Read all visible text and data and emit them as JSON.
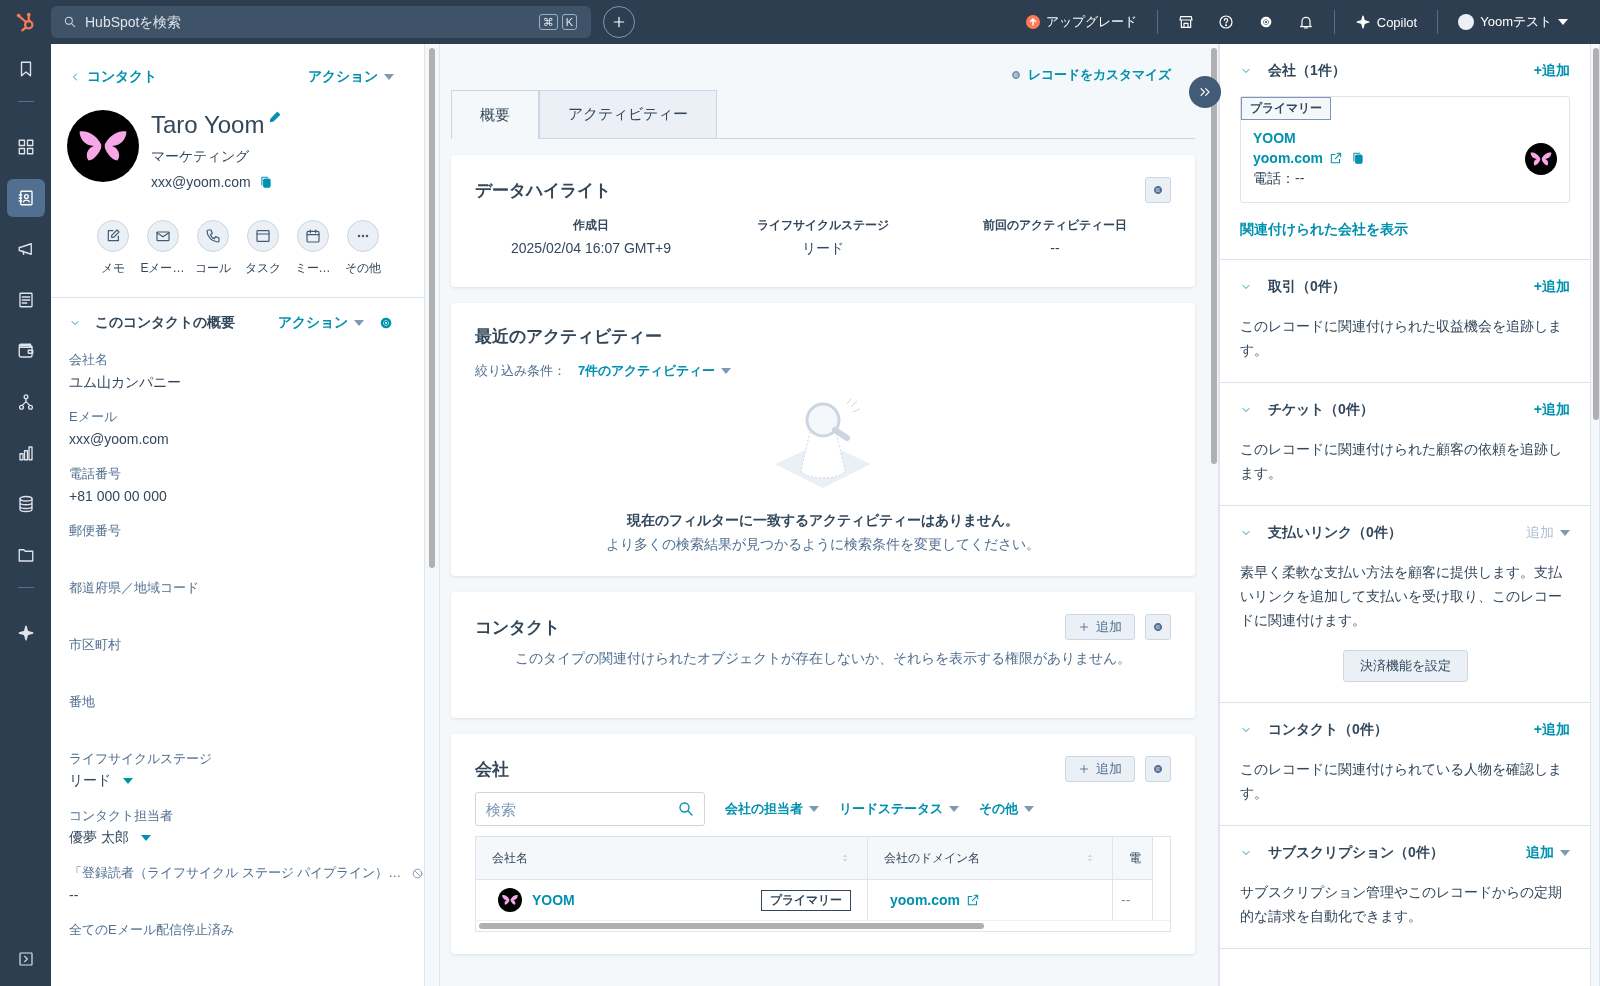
{
  "topbar": {
    "search_placeholder": "HubSpotを検索",
    "shortcut_keys": [
      "⌘",
      "K"
    ],
    "upgrade": "アップグレード",
    "copilot": "Copilot",
    "user": "Yoomテスト"
  },
  "rail": {
    "groups": [
      [
        {
          "kind": "bookmark",
          "selected": false
        }
      ],
      [
        {
          "kind": "grid",
          "selected": false
        },
        {
          "kind": "contacts",
          "selected": true
        },
        {
          "kind": "megaphone",
          "selected": false
        },
        {
          "kind": "document",
          "selected": false
        },
        {
          "kind": "wallet",
          "selected": false
        },
        {
          "kind": "network",
          "selected": false
        },
        {
          "kind": "chart",
          "selected": false
        },
        {
          "kind": "database",
          "selected": false
        },
        {
          "kind": "folder",
          "selected": false
        }
      ],
      [
        {
          "kind": "sparkle",
          "selected": false
        }
      ]
    ]
  },
  "contact": {
    "back": "コンタクト",
    "actions": "アクション",
    "name": "Taro Yoom",
    "job": "マーケティング",
    "email": "xxx@yoom.com",
    "quick_actions": [
      {
        "kind": "note",
        "label": "メモ"
      },
      {
        "kind": "email",
        "label": "Eメー…"
      },
      {
        "kind": "call",
        "label": "コール"
      },
      {
        "kind": "task",
        "label": "タスク"
      },
      {
        "kind": "meeting",
        "label": "ミー…"
      },
      {
        "kind": "more",
        "label": "その他"
      }
    ],
    "about": {
      "title": "このコンタクトの概要",
      "actions": "アクション",
      "expanded": true,
      "fields": [
        {
          "kind": "text",
          "label": "会社名",
          "value": "ユム山カンパニー"
        },
        {
          "kind": "text",
          "label": "Eメール",
          "value": "xxx@yoom.com"
        },
        {
          "kind": "text",
          "label": "電話番号",
          "value": "+81 000 00 000"
        },
        {
          "kind": "blank",
          "label": "郵便番号"
        },
        {
          "kind": "blank",
          "label": "都道府県／地域コード"
        },
        {
          "kind": "blank",
          "label": "市区町村"
        },
        {
          "kind": "blank",
          "label": "番地"
        },
        {
          "kind": "dropdown",
          "label": "ライフサイクルステージ",
          "value": "リード"
        },
        {
          "kind": "dropdown",
          "label": "コンタクト担当者",
          "value": "優夢 太郎"
        },
        {
          "kind": "restricted",
          "label": "「登録読者（ライフサイクル ステージ パイプライン）…",
          "value": "--"
        },
        {
          "kind": "blank",
          "label": "全てのEメール配信停止済み"
        }
      ]
    }
  },
  "center": {
    "customize": "レコードをカスタマイズ",
    "tabs": [
      {
        "label": "概要",
        "selected": true
      },
      {
        "label": "アクティビティー",
        "selected": false
      }
    ],
    "highlights": {
      "title": "データハイライト",
      "items": [
        {
          "label": "作成日",
          "value": "2025/02/04 16:07 GMT+9"
        },
        {
          "label": "ライフサイクルステージ",
          "value": "リード"
        },
        {
          "label": "前回のアクティビティー日",
          "value": "--"
        }
      ]
    },
    "activity": {
      "title": "最近のアクティビティー",
      "filter_label": "絞り込み条件：",
      "filter_value": "7件のアクティビティー",
      "empty_title": "現在のフィルターに一致するアクティビティーはありません。",
      "empty_text": "より多くの検索結果が見つかるように検索条件を変更してください。"
    },
    "contacts": {
      "title": "コンタクト",
      "add": "追加",
      "empty_text": "このタイプの関連付けられたオブジェクトが存在しないか、それらを表示する権限がありません。"
    },
    "companies": {
      "title": "会社",
      "add": "追加",
      "search_placeholder": "検索",
      "filters": [
        "会社の担当者",
        "リードステータス",
        "その他"
      ],
      "table": {
        "columns": [
          "会社名",
          "会社のドメイン名",
          "電"
        ],
        "rows": [
          {
            "name": "YOOM",
            "tag": "プライマリー",
            "domain": "yoom.com",
            "column_3": "--"
          }
        ]
      }
    }
  },
  "sidebar": {
    "sections": [
      {
        "kind": "company",
        "title": "会社（1件）",
        "add": {
          "label": "+追加",
          "dropdown": false,
          "disabled": false
        },
        "company": {
          "tag": "プライマリー",
          "name": "YOOM",
          "domain": "yoom.com",
          "phone": "電話：--"
        },
        "view_link": "関連付けられた会社を表示"
      },
      {
        "kind": "text",
        "title": "取引（0件）",
        "add": {
          "label": "+追加",
          "dropdown": false,
          "disabled": false
        },
        "description": "このレコードに関連付けられた収益機会を追跡します。"
      },
      {
        "kind": "text",
        "title": "チケット（0件）",
        "add": {
          "label": "+追加",
          "dropdown": false,
          "disabled": false
        },
        "description": "このレコードに関連付けられた顧客の依頼を追跡します。"
      },
      {
        "kind": "text",
        "title": "支払いリンク（0件）",
        "add": {
          "label": "追加",
          "dropdown": true,
          "disabled": true
        },
        "description": "素早く柔軟な支払い方法を顧客に提供します。支払いリンクを追加して支払いを受け取り、このレコードに関連付けます。",
        "button": "決済機能を設定"
      },
      {
        "kind": "text",
        "title": "コンタクト（0件）",
        "add": {
          "label": "+追加",
          "dropdown": false,
          "disabled": false
        },
        "description": "このレコードに関連付けられている人物を確認します。"
      },
      {
        "kind": "text",
        "title": "サブスクリプション（0件）",
        "add": {
          "label": "追加",
          "dropdown": true,
          "disabled": false
        },
        "description": "サブスクリプション管理やこのレコードからの定期的な請求を自動化できます。"
      }
    ]
  }
}
